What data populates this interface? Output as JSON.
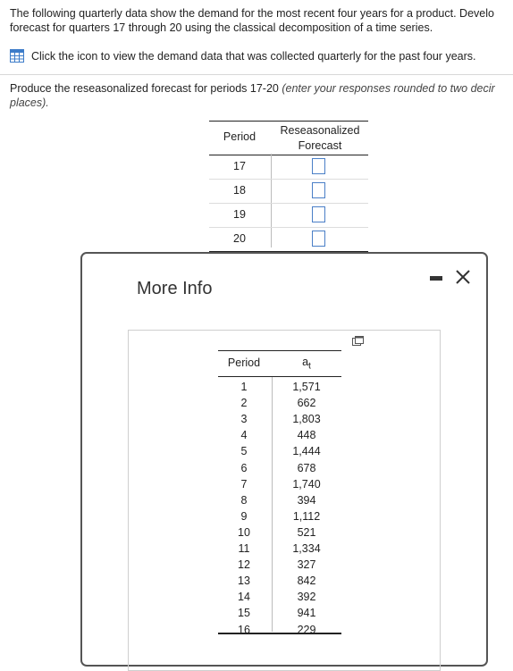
{
  "question": {
    "line1": "The following quarterly data show the demand for the most recent four years for a product. Develo",
    "line2": "forecast for quarters 17 through 20 using the classical decomposition of a time series.",
    "data_link_text": "Click the icon to view the demand data that was collected quarterly for the past four years.",
    "instruction_text": "Produce the reseasonalized forecast for periods 17-20 ",
    "instruction_hint": "(enter your responses rounded to two decir",
    "instruction_line2": "places)."
  },
  "answer_table": {
    "col_period": "Period",
    "col_forecast_line1": "Reseasonalized",
    "col_forecast_line2": "Forecast",
    "rows": [
      {
        "period": "17",
        "value": ""
      },
      {
        "period": "18",
        "value": ""
      },
      {
        "period": "19",
        "value": ""
      },
      {
        "period": "20",
        "value": ""
      }
    ]
  },
  "dialog": {
    "title": "More Info",
    "minimize_label": "-",
    "close_label": "X",
    "table": {
      "col_period": "Period",
      "col_value_base": "a",
      "col_value_sub": "t",
      "rows": [
        {
          "period": "1",
          "value": "1,571"
        },
        {
          "period": "2",
          "value": "662"
        },
        {
          "period": "3",
          "value": "1,803"
        },
        {
          "period": "4",
          "value": "448"
        },
        {
          "period": "5",
          "value": "1,444"
        },
        {
          "period": "6",
          "value": "678"
        },
        {
          "period": "7",
          "value": "1,740"
        },
        {
          "period": "8",
          "value": "394"
        },
        {
          "period": "9",
          "value": "1,112"
        },
        {
          "period": "10",
          "value": "521"
        },
        {
          "period": "11",
          "value": "1,334"
        },
        {
          "period": "12",
          "value": "327"
        },
        {
          "period": "13",
          "value": "842"
        },
        {
          "period": "14",
          "value": "392"
        },
        {
          "period": "15",
          "value": "941"
        },
        {
          "period": "16",
          "value": "229"
        }
      ]
    }
  },
  "colors": {
    "input_border": "#4a7fc7",
    "link_icon": "#3d7cc9"
  },
  "icons": {
    "data_link": "table-icon",
    "copy": "copy-icon",
    "close": "close-icon",
    "minimize": "minimize-icon"
  }
}
